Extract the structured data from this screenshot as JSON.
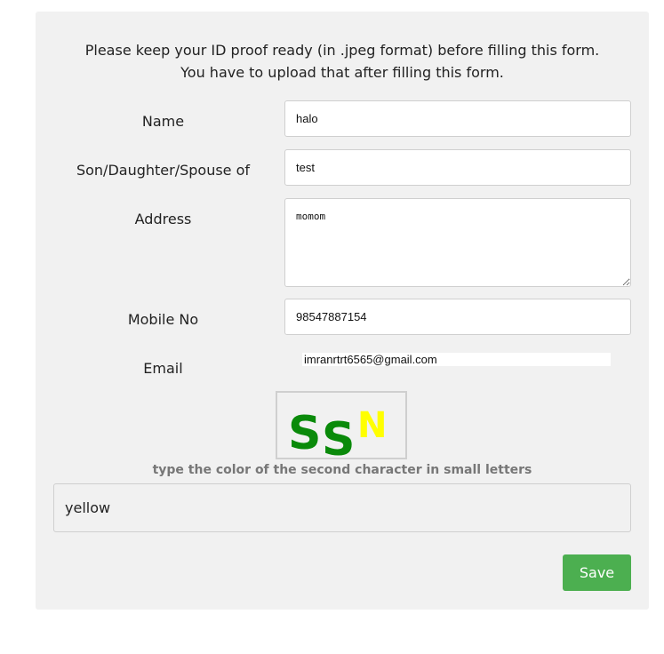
{
  "notice": "Please keep your ID proof ready (in .jpeg format) before filling this form. You have to upload that after filling this form.",
  "form": {
    "name": {
      "label": "Name",
      "value": "halo"
    },
    "relation": {
      "label": "Son/Daughter/Spouse of",
      "value": "test"
    },
    "address": {
      "label": "Address",
      "value": "momom"
    },
    "mobile": {
      "label": "Mobile No",
      "value": "98547887154"
    },
    "email": {
      "label": "Email",
      "value": "imranrtrt6565@gmail.com"
    }
  },
  "captcha": {
    "characters": [
      {
        "char": "S",
        "color": "#0a8a0a"
      },
      {
        "char": "S",
        "color": "#0a8a0a"
      },
      {
        "char": "N",
        "color": "#ffff00"
      }
    ],
    "hint": "type the color of the second character in small letters",
    "answer": "yellow"
  },
  "save_label": "Save"
}
